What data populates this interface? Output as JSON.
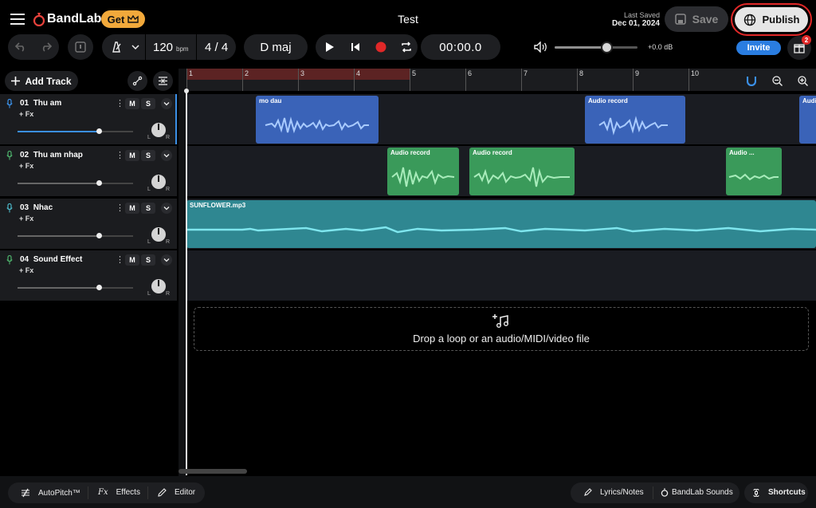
{
  "header": {
    "brand": "BandLab",
    "get_label": "Get",
    "project_title": "Test",
    "last_saved_label": "Last Saved",
    "last_saved_date": "Dec 01, 2024",
    "save_label": "Save",
    "publish_label": "Publish"
  },
  "toolbar": {
    "tempo_value": "120",
    "tempo_unit": "bpm",
    "time_signature": "4 / 4",
    "key": "D maj",
    "time_display": "00:00.0",
    "volume_db": "+0.0 dB",
    "volume_level": 0.64,
    "invite_label": "Invite",
    "notification_count": "2"
  },
  "tracks_panel": {
    "add_track_label": "Add Track",
    "tracks": [
      {
        "number": "01",
        "name": "Thu am",
        "fx_label": "+ Fx",
        "mute": "M",
        "solo": "S",
        "volume": 0.7,
        "mic_color": "#3b8fe6"
      },
      {
        "number": "02",
        "name": "Thu am nhap",
        "fx_label": "+ Fx",
        "mute": "M",
        "solo": "S",
        "volume": 0.7,
        "mic_color": "#4caf6a"
      },
      {
        "number": "03",
        "name": "Nhac",
        "fx_label": "+ Fx",
        "mute": "M",
        "solo": "S",
        "volume": 0.7,
        "mic_color": "#4ab3c4"
      },
      {
        "number": "04",
        "name": "Sound Effect",
        "fx_label": "+ Fx",
        "mute": "M",
        "solo": "S",
        "volume": 0.7,
        "mic_color": "#4caf6a"
      }
    ],
    "pan_left": "L",
    "pan_right": "R"
  },
  "timeline": {
    "bars": [
      "1",
      "2",
      "3",
      "4",
      "5",
      "6",
      "7",
      "8",
      "9",
      "10"
    ],
    "clips": {
      "t1c1": "mo dau",
      "t1c2": "Audio record",
      "t1c3": "Audi",
      "t2c1": "Audio record",
      "t2c2": "Audio record",
      "t2c3": "Audio ...",
      "t3c1": "SUNFLOWER.mp3"
    },
    "drop_text": "Drop a loop or an audio/MIDI/video file"
  },
  "bottom_bar": {
    "autopitch": "AutoPitch™",
    "effects": "Effects",
    "editor": "Editor",
    "lyrics": "Lyrics/Notes",
    "sounds": "BandLab Sounds",
    "shortcuts": "Shortcuts"
  },
  "colors": {
    "accent_blue": "#2a7de1",
    "get_orange": "#f2a93b",
    "clip_blue": "#3a63b8",
    "clip_green": "#3a9a5a",
    "clip_teal": "#3aa0a8",
    "record_red": "#e02828"
  }
}
